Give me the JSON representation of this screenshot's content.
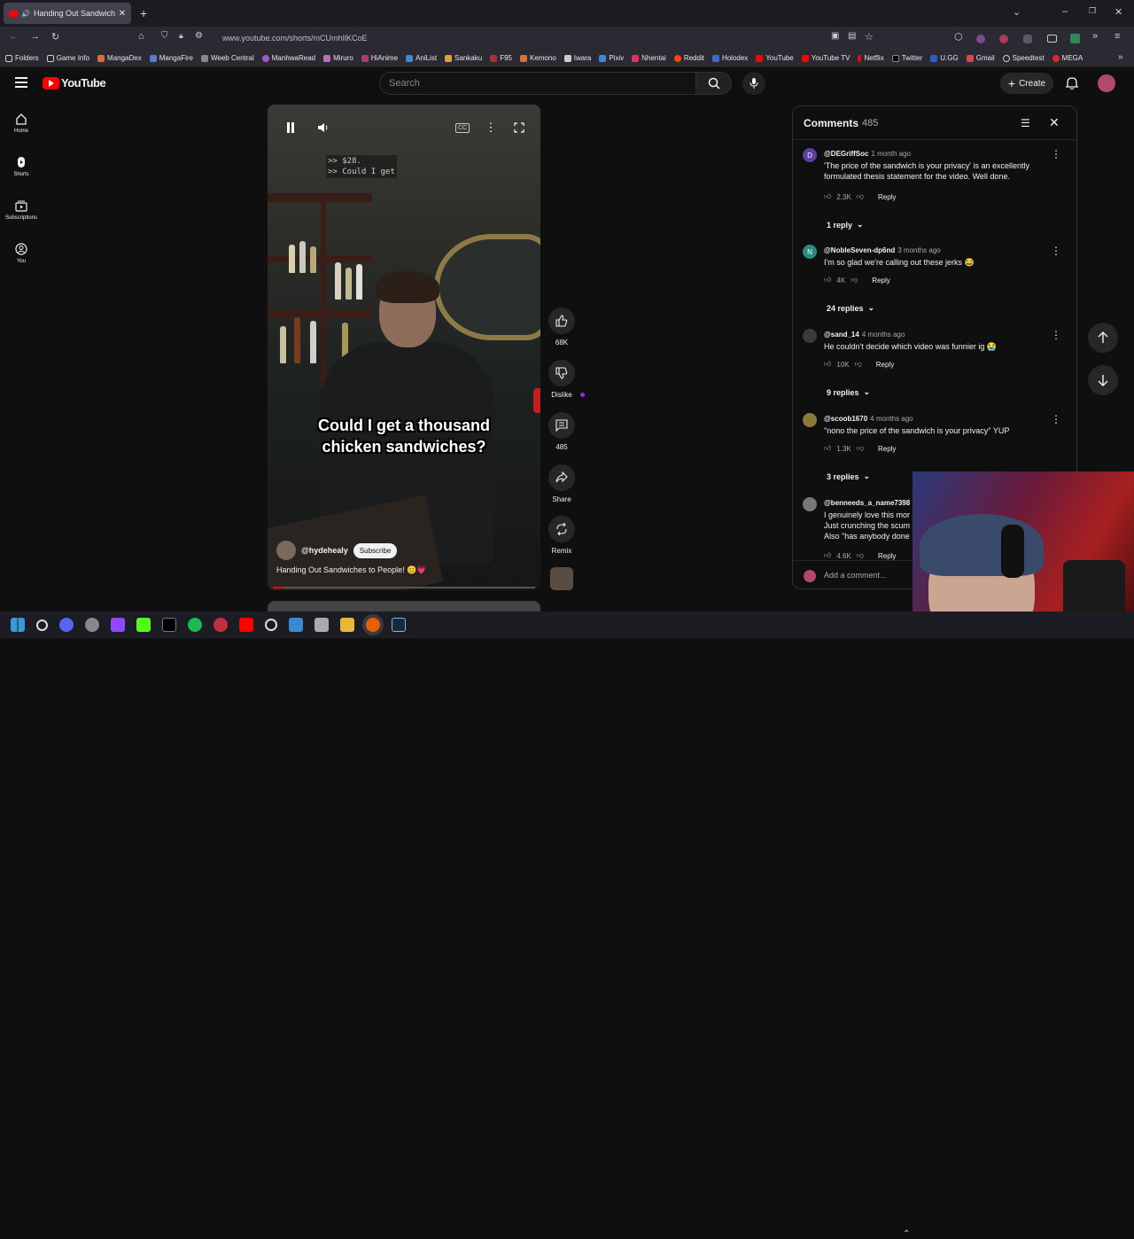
{
  "browser": {
    "tab_title": "Handing Out Sandwiches to People!",
    "url": "www.youtube.com/shorts/mCUmhIlKCoE",
    "bookmarks": [
      "Folders",
      "Game Info",
      "MangaDex",
      "MangaFire",
      "Weeb Central",
      "ManhwaRead",
      "Miruro",
      "HiAnime",
      "AniList",
      "Sankaku",
      "F95",
      "Kemono",
      "Iwara",
      "Pixiv",
      "Nhentai",
      "Reddit",
      "Holodex",
      "YouTube",
      "YouTube TV",
      "Netflix",
      "Twitter",
      "U.GG",
      "Gmail",
      "Speedtest",
      "MEGA"
    ]
  },
  "youtube": {
    "logo_text": "YouTube",
    "search_placeholder": "Search",
    "create_label": "Create",
    "guide": [
      {
        "label": "Home"
      },
      {
        "label": "Shorts"
      },
      {
        "label": "Subscriptions"
      },
      {
        "label": "You"
      }
    ]
  },
  "video": {
    "caption_small_1": ">> $28.",
    "caption_small_2": ">> Could I get",
    "caption_main_1": "Could I get a thousand",
    "caption_main_2": "chicken sandwiches?",
    "channel": "@hydehealy",
    "subscribe_label": "Subscribe",
    "title": "Handing Out Sandwiches to People! 😊💗",
    "progress": 0.04
  },
  "actions": {
    "likes": "68K",
    "dislike": "Dislike",
    "comments": "485",
    "share": "Share",
    "remix": "Remix"
  },
  "comments": {
    "title": "Comments",
    "count": "485",
    "add_placeholder": "Add a comment...",
    "reply_label": "Reply",
    "items": [
      {
        "author": "@DEGriffSoc",
        "time": "1 month ago",
        "text": "'The price of the sandwich is your privacy' is an excellently formulated thesis statement for the video. Well done.",
        "likes": "2.3K",
        "replies": "1 reply",
        "initial": "D",
        "color": "#5c3f9e"
      },
      {
        "author": "@NobleSeven-dp6nd",
        "time": "3 months ago",
        "text": "I'm so glad we're calling out these jerks 😂",
        "likes": "4K",
        "replies": "24 replies",
        "initial": "N",
        "color": "#2b8a80"
      },
      {
        "author": "@sand_14",
        "time": "4 months ago",
        "text": "He couldn't decide which video was funnier ig 😭",
        "likes": "10K",
        "replies": "9 replies",
        "initial": "",
        "color": "#3a3a3a"
      },
      {
        "author": "@scoob1670",
        "time": "4 months ago",
        "text": "\"nono the price of the sandwich is your privacy\" YUP",
        "likes": "1.3K",
        "replies": "3 replies",
        "initial": "",
        "color": "#8a7a3a"
      },
      {
        "author": "@benneeds_a_name7398",
        "time": "",
        "text": "I genuinely love this mor Just crunching the scum Also \"has anybody done",
        "likes": "4.6K",
        "replies": "",
        "initial": "",
        "color": "#777"
      }
    ]
  }
}
